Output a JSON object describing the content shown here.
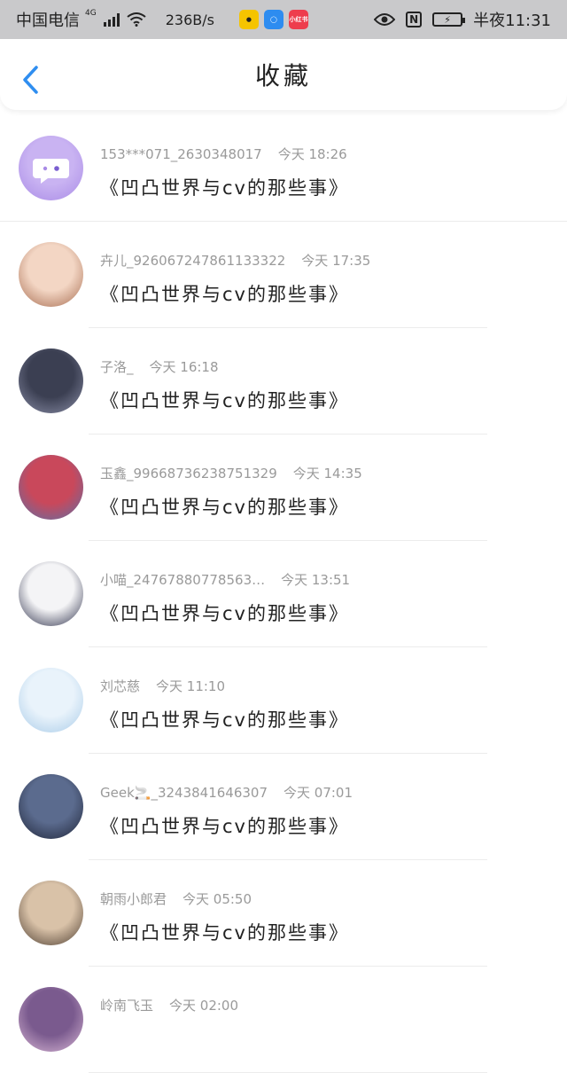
{
  "status_bar": {
    "carrier": "中国电信",
    "network": "4G",
    "speed": "236B/s",
    "app_icons": [
      "app-yellow",
      "app-blue",
      "小红书"
    ],
    "time": "半夜11:31",
    "battery_glyph": "⚡"
  },
  "header": {
    "title": "收藏"
  },
  "favorites": [
    {
      "user": "153***071_2630348017",
      "time": "今天 18:26",
      "title": "《凹凸世界与cv的那些事》",
      "avatar_colors": [
        "#c9b3f2",
        "#a98be6"
      ]
    },
    {
      "user": "卉儿_926067247861133322",
      "time": "今天 17:35",
      "title": "《凹凸世界与cv的那些事》",
      "avatar_colors": [
        "#f3d6c4",
        "#a56a4e"
      ]
    },
    {
      "user": "子洛_",
      "time": "今天 16:18",
      "title": "《凹凸世界与cv的那些事》",
      "avatar_colors": [
        "#3b3f52",
        "#8b8fa8"
      ]
    },
    {
      "user": "玉鑫_99668736238751329",
      "time": "今天 14:35",
      "title": "《凹凸世界与cv的那些事》",
      "avatar_colors": [
        "#c9485b",
        "#5a6fa8"
      ]
    },
    {
      "user": "小喵_24767880778563…",
      "time": "今天 13:51",
      "title": "《凹凸世界与cv的那些事》",
      "avatar_colors": [
        "#f4f4f6",
        "#2b2e48"
      ]
    },
    {
      "user": "刘芯慈",
      "time": "今天 11:10",
      "title": "《凹凸世界与cv的那些事》",
      "avatar_colors": [
        "#e9f3fb",
        "#a8cbe8"
      ]
    },
    {
      "user": "Geek🚬_3243841646307",
      "time": "今天 07:01",
      "title": "《凹凸世界与cv的那些事》",
      "avatar_colors": [
        "#5b6b8e",
        "#1e2437"
      ]
    },
    {
      "user": "朝雨小郎君",
      "time": "今天 05:50",
      "title": "《凹凸世界与cv的那些事》",
      "avatar_colors": [
        "#d9c2a8",
        "#4a3a2e"
      ]
    },
    {
      "user": "岭南飞玉",
      "time": "今天 02:00",
      "title": "",
      "avatar_colors": [
        "#7a5a8e",
        "#d9b8d6"
      ]
    }
  ]
}
